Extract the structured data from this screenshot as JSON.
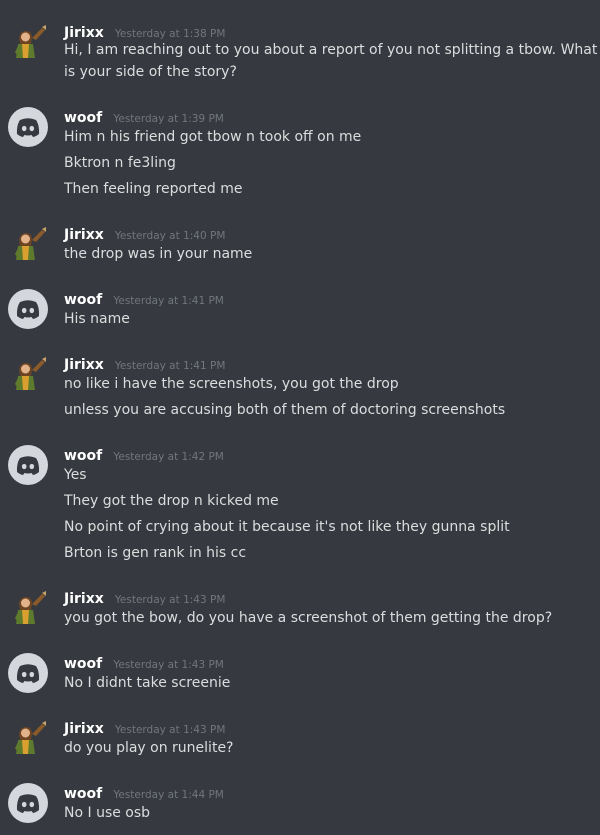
{
  "messages": [
    {
      "user": "Jirixx",
      "time": "Yesterday at 1:38 PM",
      "lines": [
        "Hi, I am reaching out to you about a report of you not splitting a tbow. What",
        "is your side of the story?"
      ]
    },
    {
      "user": "woof",
      "time": "Yesterday at 1:39 PM",
      "lines": [
        "Him n his friend got tbow n took off on me",
        "Bktron n fe3ling",
        "Then feeling reported me"
      ]
    },
    {
      "user": "Jirixx",
      "time": "Yesterday at 1:40 PM",
      "lines": [
        "the drop was in your name"
      ]
    },
    {
      "user": "woof",
      "time": "Yesterday at 1:41 PM",
      "lines": [
        "His name"
      ]
    },
    {
      "user": "Jirixx",
      "time": "Yesterday at 1:41 PM",
      "lines": [
        "no like i have the screenshots, you got the drop",
        "unless you are accusing both of them of doctoring screenshots"
      ]
    },
    {
      "user": "woof",
      "time": "Yesterday at 1:42 PM",
      "lines": [
        "Yes",
        "They got the drop n kicked me",
        "No point of crying about it because it's not like they gunna split",
        "Brton is gen rank in his cc"
      ]
    },
    {
      "user": "Jirixx",
      "time": "Yesterday at 1:43 PM",
      "lines": [
        "you got the bow, do you have a screenshot of them getting the drop?"
      ]
    },
    {
      "user": "woof",
      "time": "Yesterday at 1:43 PM",
      "lines": [
        "No I didnt take screenie"
      ]
    },
    {
      "user": "Jirixx",
      "time": "Yesterday at 1:43 PM",
      "lines": [
        "do you play on runelite?"
      ]
    },
    {
      "user": "woof",
      "time": "Yesterday at 1:44 PM",
      "lines": [
        "No I use osb"
      ]
    }
  ],
  "colors": {
    "background": "#36393f",
    "username": "#ffffff",
    "timestamp": "#72767d",
    "text": "#dcddde",
    "discord_avatar_bg": "#d4d7dc",
    "discord_logo": "#36393f"
  },
  "icons": {
    "woof": "discord-logo-avatar",
    "Jirixx": "character-avatar"
  }
}
